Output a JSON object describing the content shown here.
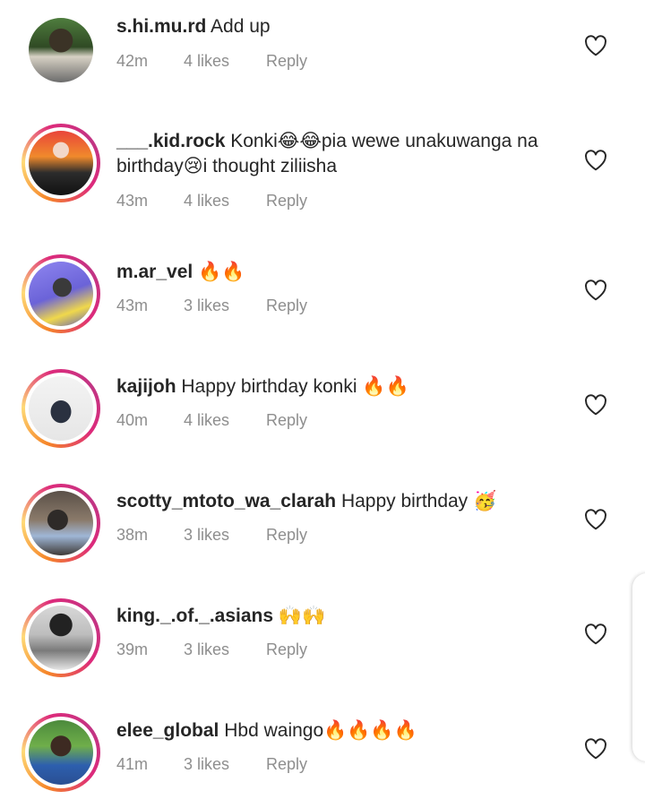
{
  "comments": [
    {
      "username": "s.hi.mu.rd",
      "text": "Add up",
      "time": "42m",
      "likes": "4 likes",
      "reply": "Reply",
      "ring": false
    },
    {
      "username": "___.kid.rock",
      "text": "Konki😂😂pia wewe unakuwanga na birthday😢i thought ziliisha",
      "time": "43m",
      "likes": "4 likes",
      "reply": "Reply",
      "ring": true
    },
    {
      "username": "m.ar_vel",
      "text": "🔥🔥",
      "time": "43m",
      "likes": "3 likes",
      "reply": "Reply",
      "ring": true
    },
    {
      "username": "kajijoh",
      "text": "Happy birthday konki 🔥🔥",
      "time": "40m",
      "likes": "4 likes",
      "reply": "Reply",
      "ring": true
    },
    {
      "username": "scotty_mtoto_wa_clarah",
      "text": "Happy birthday 🥳",
      "time": "38m",
      "likes": "3 likes",
      "reply": "Reply",
      "ring": true
    },
    {
      "username": "king._.of._.asians",
      "text": "🙌🙌",
      "time": "39m",
      "likes": "3 likes",
      "reply": "Reply",
      "ring": true
    },
    {
      "username": "elee_global",
      "text": "Hbd waingo🔥🔥🔥🔥",
      "time": "41m",
      "likes": "3 likes",
      "reply": "Reply",
      "ring": true
    }
  ],
  "colors": {
    "text": "#262626",
    "meta": "#8e8e8e",
    "ring_start": "#f58529",
    "ring_end": "#c13584"
  },
  "icons": {
    "like": "heart-outline-icon"
  }
}
